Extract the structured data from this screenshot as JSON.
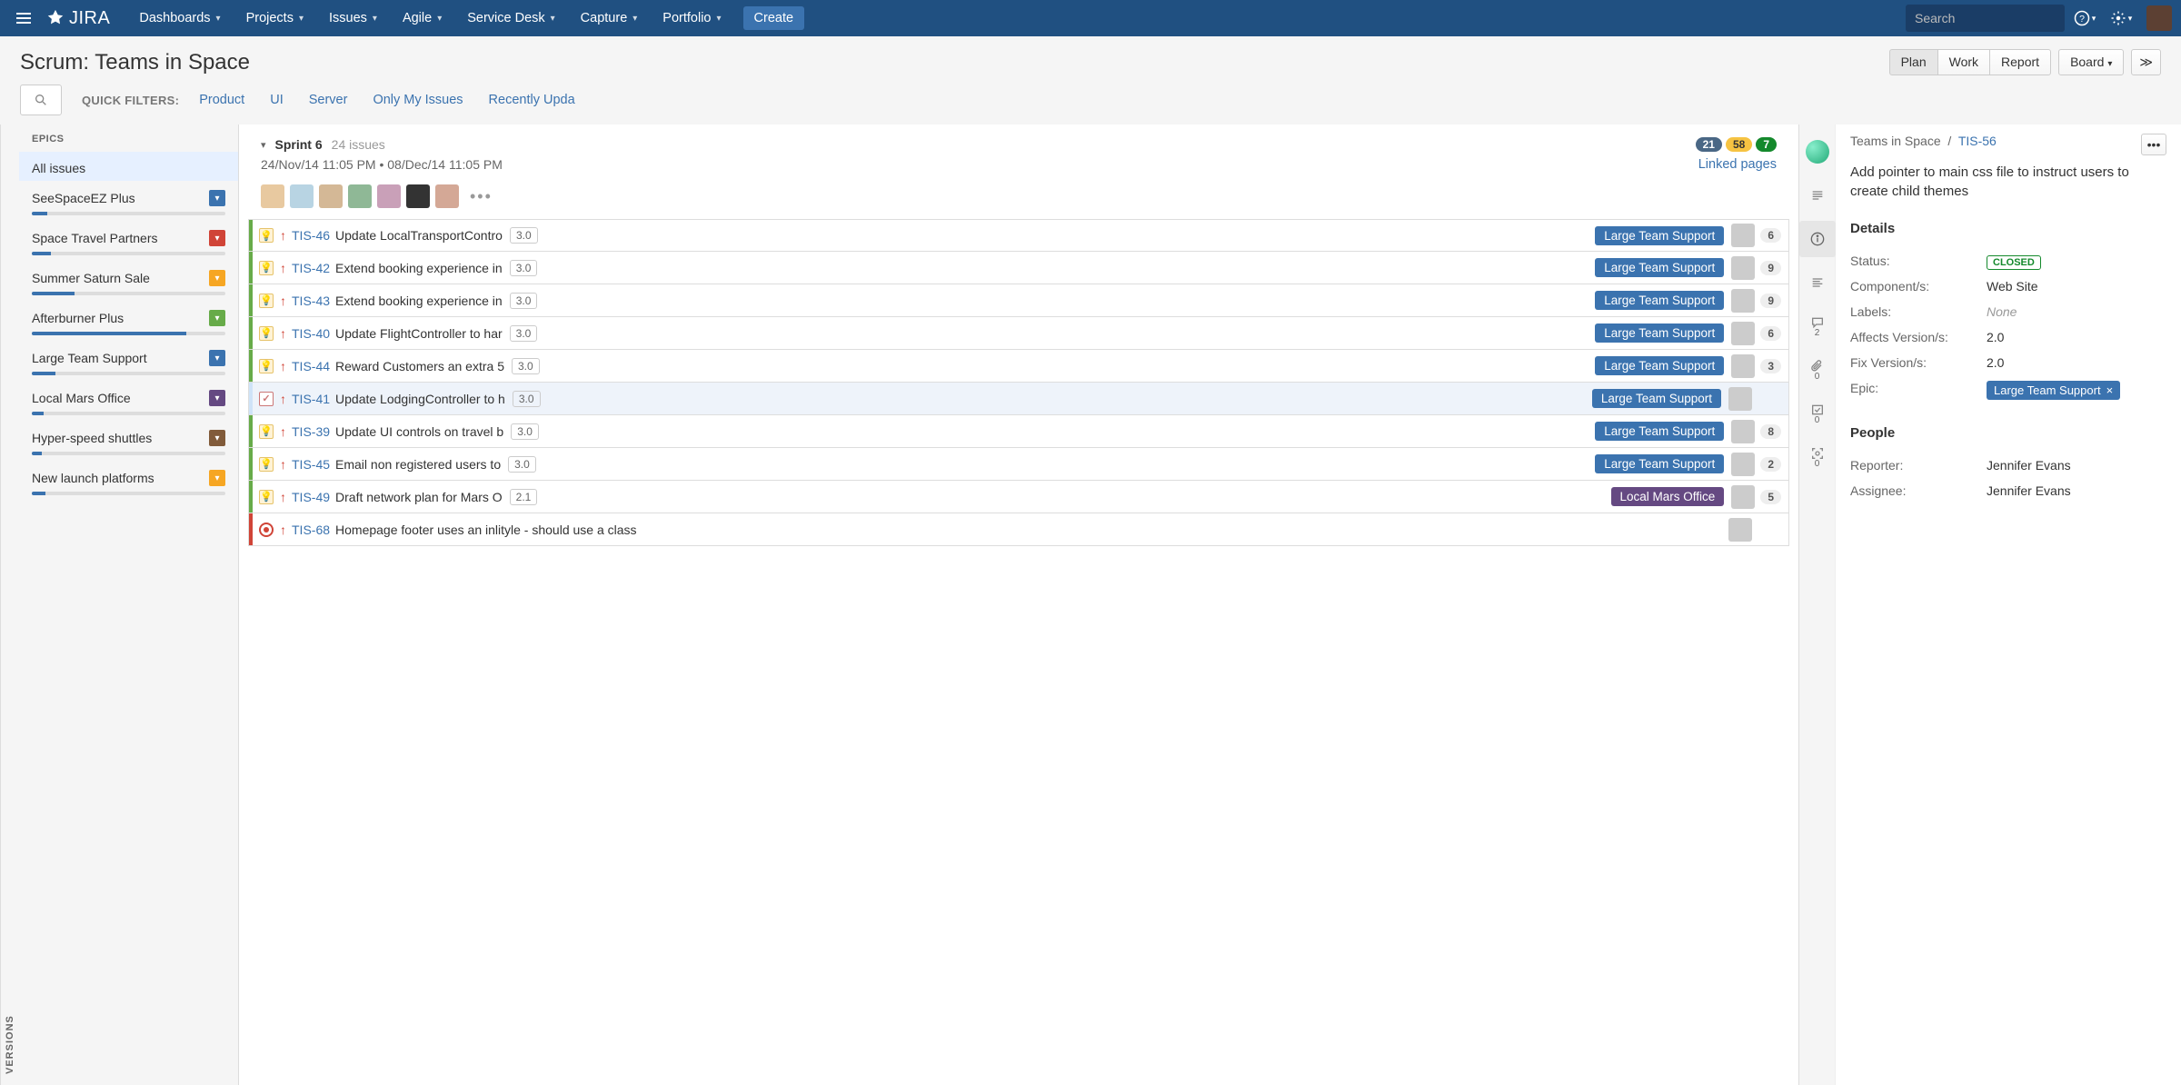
{
  "nav": {
    "logo": "JIRA",
    "items": [
      "Dashboards",
      "Projects",
      "Issues",
      "Agile",
      "Service Desk",
      "Capture",
      "Portfolio"
    ],
    "create": "Create",
    "search_placeholder": "Search"
  },
  "subheader": {
    "title": "Scrum: Teams in Space",
    "buttons": {
      "plan": "Plan",
      "work": "Work",
      "report": "Report",
      "board": "Board"
    },
    "quick_filters_label": "QUICK FILTERS:",
    "filters": [
      "Product",
      "UI",
      "Server",
      "Only My Issues",
      "Recently Upda"
    ]
  },
  "versions_tab": "VERSIONS",
  "epics": {
    "header": "EPICS",
    "all_issues": "All issues",
    "items": [
      {
        "name": "SeeSpaceEZ Plus",
        "color": "#3b73af",
        "progress": 8
      },
      {
        "name": "Space Travel Partners",
        "color": "#d04437",
        "progress": 10
      },
      {
        "name": "Summer Saturn Sale",
        "color": "#f6a623",
        "progress": 22
      },
      {
        "name": "Afterburner Plus",
        "color": "#67ab49",
        "progress": 80
      },
      {
        "name": "Large Team Support",
        "color": "#3b73af",
        "progress": 12
      },
      {
        "name": "Local Mars Office",
        "color": "#654982",
        "progress": 6
      },
      {
        "name": "Hyper-speed shuttles",
        "color": "#815b3a",
        "progress": 5
      },
      {
        "name": "New launch platforms",
        "color": "#f6a623",
        "progress": 7
      }
    ]
  },
  "sprint": {
    "name": "Sprint 6",
    "count_label": "24 issues",
    "badge_gray": "21",
    "badge_yellow": "58",
    "badge_green": "7",
    "dates": "24/Nov/14 11:05 PM  •  08/Dec/14 11:05 PM",
    "linked_pages": "Linked pages"
  },
  "issues": [
    {
      "stripe": "#67ab49",
      "type": "idea",
      "key": "TIS-46",
      "summary": "Update LocalTransportContro",
      "est": "3.0",
      "epic": "Large Team Support",
      "epic_color": "#3b73af",
      "count": "6"
    },
    {
      "stripe": "#67ab49",
      "type": "idea",
      "key": "TIS-42",
      "summary": "Extend booking experience in",
      "est": "3.0",
      "epic": "Large Team Support",
      "epic_color": "#3b73af",
      "count": "9"
    },
    {
      "stripe": "#67ab49",
      "type": "idea",
      "key": "TIS-43",
      "summary": "Extend booking experience in",
      "est": "3.0",
      "epic": "Large Team Support",
      "epic_color": "#3b73af",
      "count": "9"
    },
    {
      "stripe": "#67ab49",
      "type": "idea",
      "key": "TIS-40",
      "summary": "Update FlightController to har",
      "est": "3.0",
      "epic": "Large Team Support",
      "epic_color": "#3b73af",
      "count": "6"
    },
    {
      "stripe": "#67ab49",
      "type": "idea",
      "key": "TIS-44",
      "summary": "Reward Customers an extra 5",
      "est": "3.0",
      "epic": "Large Team Support",
      "epic_color": "#3b73af",
      "count": "3"
    },
    {
      "stripe": "#cfe3f8",
      "type": "task",
      "key": "TIS-41",
      "summary": "Update LodgingController to h",
      "est": "3.0",
      "epic": "Large Team Support",
      "epic_color": "#3b73af",
      "count": "",
      "selected": true
    },
    {
      "stripe": "#67ab49",
      "type": "idea",
      "key": "TIS-39",
      "summary": "Update UI controls on travel b",
      "est": "3.0",
      "epic": "Large Team Support",
      "epic_color": "#3b73af",
      "count": "8"
    },
    {
      "stripe": "#67ab49",
      "type": "idea",
      "key": "TIS-45",
      "summary": "Email non registered users to",
      "est": "3.0",
      "epic": "Large Team Support",
      "epic_color": "#3b73af",
      "count": "2"
    },
    {
      "stripe": "#67ab49",
      "type": "idea",
      "key": "TIS-49",
      "summary": "Draft network plan for Mars O",
      "est": "2.1",
      "epic": "Local Mars Office",
      "epic_color": "#654982",
      "count": "5"
    },
    {
      "stripe": "#d04437",
      "type": "bug",
      "key": "TIS-68",
      "summary": "Homepage footer uses an inlityle - should use a class",
      "est": "",
      "epic": "",
      "epic_color": "",
      "count": ""
    }
  ],
  "detail_icons": {
    "comments_count": "2",
    "attachments_count": "0",
    "subtasks_count": "0",
    "screenshots_count": "0"
  },
  "detail": {
    "project": "Teams in Space",
    "key": "TIS-56",
    "title": "Add pointer to main css file to instruct users to create child themes",
    "sections": {
      "details_h": "Details",
      "people_h": "People"
    },
    "fields": {
      "status_label": "Status:",
      "status_value": "CLOSED",
      "components_label": "Component/s:",
      "components_value": "Web Site",
      "labels_label": "Labels:",
      "labels_value": "None",
      "affects_label": "Affects Version/s:",
      "affects_value": "2.0",
      "fix_label": "Fix Version/s:",
      "fix_value": "2.0",
      "epic_label": "Epic:",
      "epic_value": "Large Team Support",
      "reporter_label": "Reporter:",
      "reporter_value": "Jennifer Evans",
      "assignee_label": "Assignee:",
      "assignee_value": "Jennifer Evans"
    }
  }
}
